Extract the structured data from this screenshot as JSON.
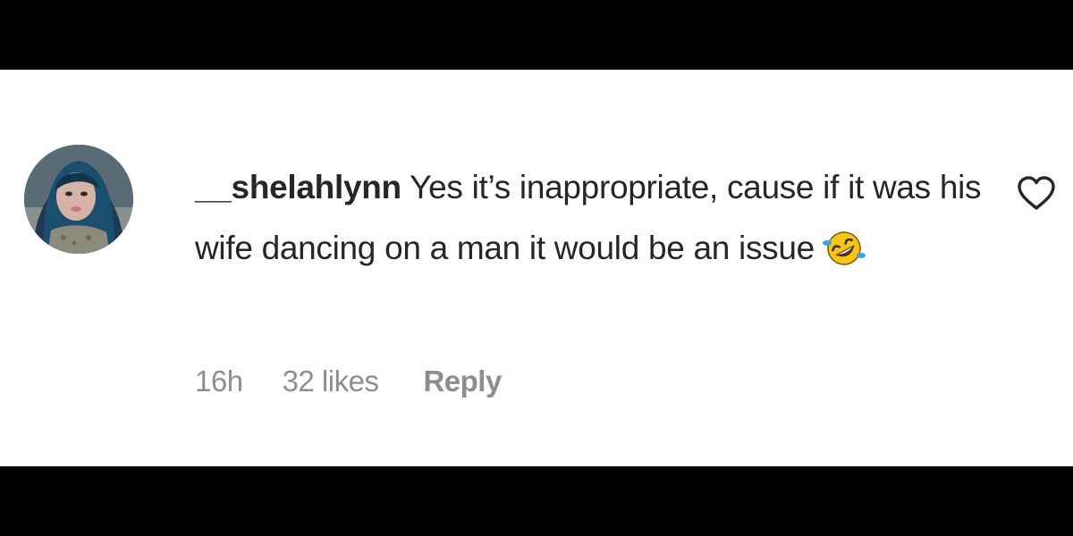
{
  "comment": {
    "username": "__shelahlynn",
    "text": "Yes it’s inappropriate, cause if it was his wife dancing on a man it would be an issue",
    "emoji": "rolling-on-floor-laughing-emoji",
    "age": "16h",
    "likes": "32 likes",
    "reply_label": "Reply"
  },
  "colors": {
    "text": "#262626",
    "meta": "#8e8e8e",
    "background": "#ffffff",
    "letterbox": "#000000"
  },
  "icons": {
    "like": "heart-outline-icon",
    "avatar": "user-avatar"
  }
}
